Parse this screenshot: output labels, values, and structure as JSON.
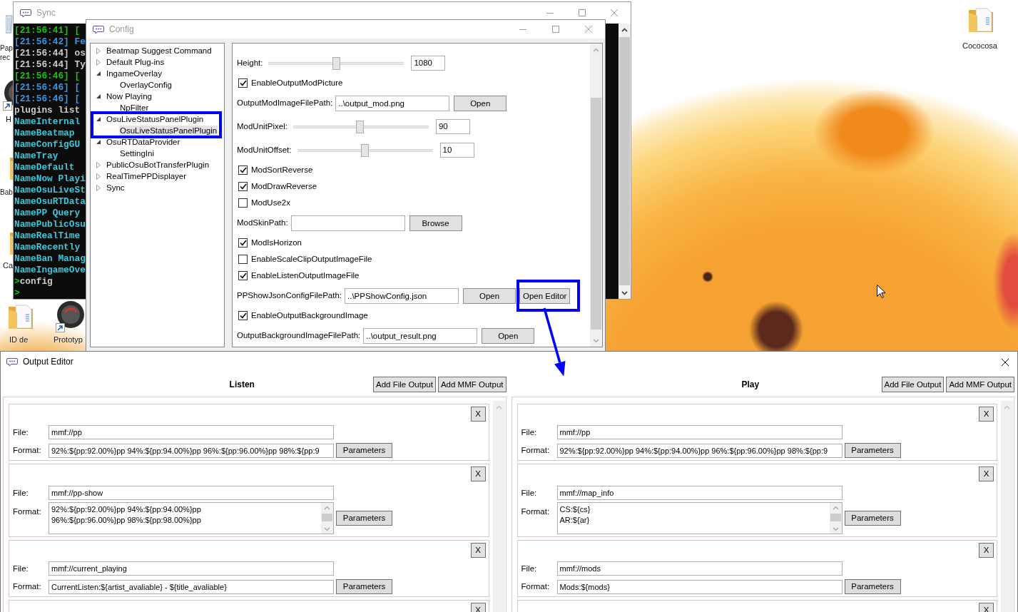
{
  "desktop": {
    "icons": [
      {
        "kind": "recycle",
        "lines": [
          "Pap",
          "rec"
        ]
      },
      {
        "kind": "app",
        "lines": [
          "H"
        ]
      },
      {
        "kind": "folder",
        "lines": [
          "Bab"
        ]
      },
      {
        "kind": "folder",
        "lines": [
          "Ca"
        ]
      },
      {
        "kind": "folder",
        "lines": [
          "ID de"
        ]
      },
      {
        "kind": "app",
        "lines": [
          "Prototyp"
        ]
      },
      {
        "kind": "folder",
        "lines": [
          "Cococosa"
        ]
      }
    ]
  },
  "sync_window": {
    "title": "Sync",
    "active": false,
    "console": [
      {
        "kind": "log",
        "color": "#16c60c",
        "text": "[21:56:41] ["
      },
      {
        "kind": "log",
        "color": "#3a96dd",
        "text": "[21:56:42] Fe"
      },
      {
        "kind": "log",
        "color": "#cccccc",
        "text": "[21:56:44] os"
      },
      {
        "kind": "log",
        "color": "#cccccc",
        "text": "[21:56:44] Ty"
      },
      {
        "kind": "log",
        "color": "#16c60c",
        "text": "[21:56:46] ["
      },
      {
        "kind": "log",
        "color": "#3a96dd",
        "text": "[21:56:46] ["
      },
      {
        "kind": "log",
        "color": "#3a96dd",
        "text": "[21:56:46] ["
      },
      {
        "kind": "log",
        "color": "#cccccc",
        "text": "plugins list"
      },
      {
        "kind": "log",
        "color": "#3bc8d8",
        "text": "NameInternal"
      },
      {
        "kind": "log",
        "color": "#3bc8d8",
        "text": "NameBeatmap"
      },
      {
        "kind": "log",
        "color": "#3bc8d8",
        "text": "NameConfigGU"
      },
      {
        "kind": "log",
        "color": "#3bc8d8",
        "text": "NameTray"
      },
      {
        "kind": "log",
        "color": "#3bc8d8",
        "text": "NameDefault"
      },
      {
        "kind": "log",
        "color": "#3bc8d8",
        "text": "NameNow Playi"
      },
      {
        "kind": "log",
        "color": "#3bc8d8",
        "text": "NameOsuLiveSt"
      },
      {
        "kind": "log",
        "color": "#3bc8d8",
        "text": "NameOsuRTData"
      },
      {
        "kind": "log",
        "color": "#3bc8d8",
        "text": "NamePP Query"
      },
      {
        "kind": "log",
        "color": "#3bc8d8",
        "text": "NamePublicOsu"
      },
      {
        "kind": "log",
        "color": "#3bc8d8",
        "text": "NameRealTime"
      },
      {
        "kind": "log",
        "color": "#3bc8d8",
        "text": "NameRecently"
      },
      {
        "kind": "log",
        "color": "#3bc8d8",
        "text": "NameBan Manag"
      },
      {
        "kind": "log",
        "color": "#3bc8d8",
        "text": "NameIngameOve"
      },
      {
        "kind": "input",
        "prompt": ">",
        "text": "config"
      },
      {
        "kind": "input",
        "prompt": ">"
      }
    ]
  },
  "config_window": {
    "title": "Config",
    "active": false,
    "tree": [
      {
        "label": "Beatmap Suggest Command",
        "expanded": false,
        "selected": false
      },
      {
        "label": "Default Plug-ins",
        "expanded": false,
        "selected": false
      },
      {
        "label": "IngameOverlay",
        "expanded": true,
        "selected": false,
        "children": [
          {
            "label": "OverlayConfig",
            "selected": false
          }
        ]
      },
      {
        "label": "Now Playing",
        "expanded": true,
        "selected": false,
        "children": [
          {
            "label": "NpFilter",
            "selected": false
          }
        ]
      },
      {
        "label": "OsuLiveStatusPanelPlugin",
        "expanded": true,
        "selected": false,
        "annotated": true,
        "children": [
          {
            "label": "OsuLiveStatusPanelPlugin",
            "selected": true
          }
        ]
      },
      {
        "label": "OsuRTDataProvider",
        "expanded": true,
        "selected": false,
        "children": [
          {
            "label": "SettingIni",
            "selected": false
          }
        ]
      },
      {
        "label": "PublicOsuBotTransferPlugin",
        "expanded": false,
        "selected": false
      },
      {
        "label": "RealTimePPDisplayer",
        "expanded": false,
        "selected": false
      },
      {
        "label": "Sync",
        "expanded": false,
        "selected": false
      }
    ],
    "settings": [
      {
        "kind": "slider",
        "label": "Height:",
        "level": 0.5,
        "value": "1080"
      },
      {
        "kind": "checkbox",
        "label": "EnableOutputModPicture",
        "checked": true
      },
      {
        "kind": "path",
        "label": "OutputModImageFilePath:",
        "value": "..\\output_mod.png",
        "buttons": [
          {
            "label": "Open"
          }
        ]
      },
      {
        "kind": "slider",
        "label": "ModUnitPixel:",
        "level": 0.49,
        "value": "90"
      },
      {
        "kind": "slider",
        "label": "ModUnitOffset:",
        "level": 0.5,
        "value": "10"
      },
      {
        "kind": "checkbox",
        "label": "ModSortReverse",
        "checked": true
      },
      {
        "kind": "checkbox",
        "label": "ModDrawReverse",
        "checked": true
      },
      {
        "kind": "checkbox",
        "label": "ModUse2x",
        "checked": false
      },
      {
        "kind": "path",
        "label": "ModSkinPath:",
        "buttons": [
          {
            "label": "Browse"
          }
        ]
      },
      {
        "kind": "checkbox",
        "label": "ModIsHorizon",
        "checked": true
      },
      {
        "kind": "checkbox",
        "label": "EnableScaleClipOutputImageFile",
        "checked": false
      },
      {
        "kind": "checkbox",
        "label": "EnableListenOutputImageFile",
        "checked": true
      },
      {
        "kind": "path",
        "label": "PPShowJsonConfigFilePath:",
        "value": "..\\PPShowConfig.json",
        "buttons": [
          {
            "label": "Open"
          },
          {
            "label": "Open Editor",
            "annotated": true
          }
        ]
      },
      {
        "kind": "checkbox",
        "label": "EnableOutputBackgroundImage",
        "checked": true
      },
      {
        "kind": "path",
        "label": "OutputBackgroundImageFilePath:",
        "value": "..\\output_result.png",
        "buttons": [
          {
            "label": "Open"
          }
        ]
      }
    ]
  },
  "output_editor": {
    "title": "Output Editor",
    "active": true,
    "panels": [
      {
        "title": "Listen",
        "buttons": [
          "Add File Output",
          "Add MMF Output"
        ],
        "outputs": [
          {
            "kind": "single",
            "remove": "X",
            "file_label": "File:",
            "file": "mmf://pp",
            "format_label": "Format:",
            "format": "92%:${pp:92.00%}pp 94%:${pp:94.00%}pp 96%:${pp:96.00%}pp 98%:${pp:9",
            "parameters": "Parameters"
          },
          {
            "kind": "multi",
            "remove": "X",
            "file_label": "File:",
            "file": "mmf://pp-show",
            "format_label": "Format:",
            "format_lines": [
              "92%:${pp:92.00%}pp 94%:${pp:94.00%}pp",
              "96%:${pp:96.00%}pp 98%:${pp:98.00%}pp"
            ],
            "parameters": "Parameters"
          },
          {
            "kind": "single",
            "remove": "X",
            "file_label": "File:",
            "file": "mmf://current_playing",
            "format_label": "Format:",
            "format": "CurrentListen:${artist_avaliable} - ${title_avaliable}",
            "parameters": "Parameters"
          },
          {
            "kind": "stub",
            "remove": "X"
          }
        ]
      },
      {
        "title": "Play",
        "buttons": [
          "Add File Output",
          "Add MMF Output"
        ],
        "outputs": [
          {
            "kind": "single",
            "remove": "X",
            "file_label": "File:",
            "file": "mmf://pp",
            "format_label": "Format:",
            "format": "92%:${pp:92.00%}pp 94%:${pp:94.00%}pp 96%:${pp:96.00%}pp 98%:${pp:9",
            "parameters": "Parameters"
          },
          {
            "kind": "multi",
            "remove": "X",
            "file_label": "File:",
            "file": "mmf://map_info",
            "format_label": "Format:",
            "format_lines": [
              "CS:${cs}",
              "AR:${ar}"
            ],
            "parameters": "Parameters"
          },
          {
            "kind": "single",
            "remove": "X",
            "file_label": "File:",
            "file": "mmf://mods",
            "format_label": "Format:",
            "format": "Mods:${mods}",
            "parameters": "Parameters"
          },
          {
            "kind": "stub",
            "remove": "X"
          }
        ]
      }
    ]
  }
}
